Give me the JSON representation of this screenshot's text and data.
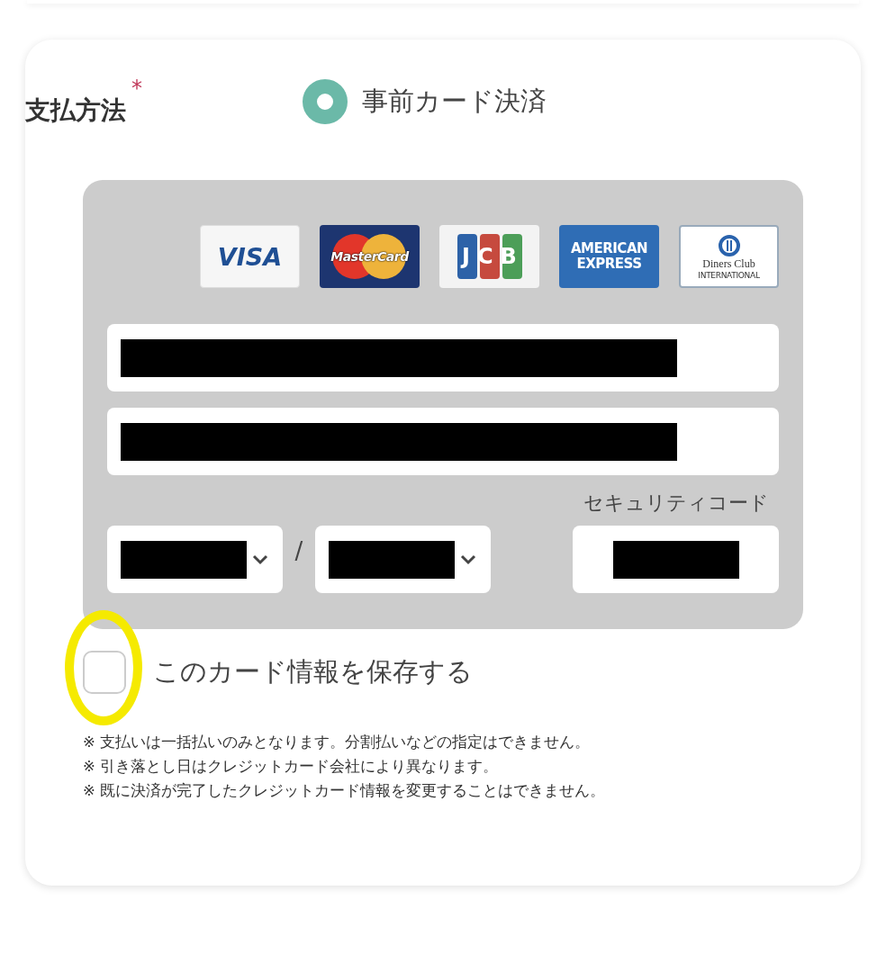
{
  "payment": {
    "label": "支払方法",
    "required_mark": "*",
    "options": [
      {
        "label": "事前カード決済",
        "selected": true
      }
    ],
    "card_brands": [
      {
        "kind": "visa",
        "label": "VISA"
      },
      {
        "kind": "mastercard",
        "label": "MasterCard"
      },
      {
        "kind": "jcb",
        "label": "JCB"
      },
      {
        "kind": "amex",
        "label": "AMERICAN EXPRESS"
      },
      {
        "kind": "diners",
        "label": "Diners Club",
        "sublabel": "INTERNATIONAL"
      }
    ],
    "card_number": {
      "redacted": true
    },
    "card_name": {
      "redacted": true
    },
    "expiry": {
      "month": {
        "redacted": true
      },
      "separator": "/",
      "year": {
        "redacted": true
      }
    },
    "security_code": {
      "label": "セキュリティコード",
      "redacted": true
    },
    "save_card": {
      "label": "このカード情報を保存する",
      "checked": false,
      "highlighted": true
    },
    "notes": [
      "※ 支払いは一括払いのみとなります。分割払いなどの指定はできません。",
      "※ 引き落とし日はクレジットカード会社により異なります。",
      "※ 既に決済が完了したクレジットカード情報を変更することはできません。"
    ]
  }
}
